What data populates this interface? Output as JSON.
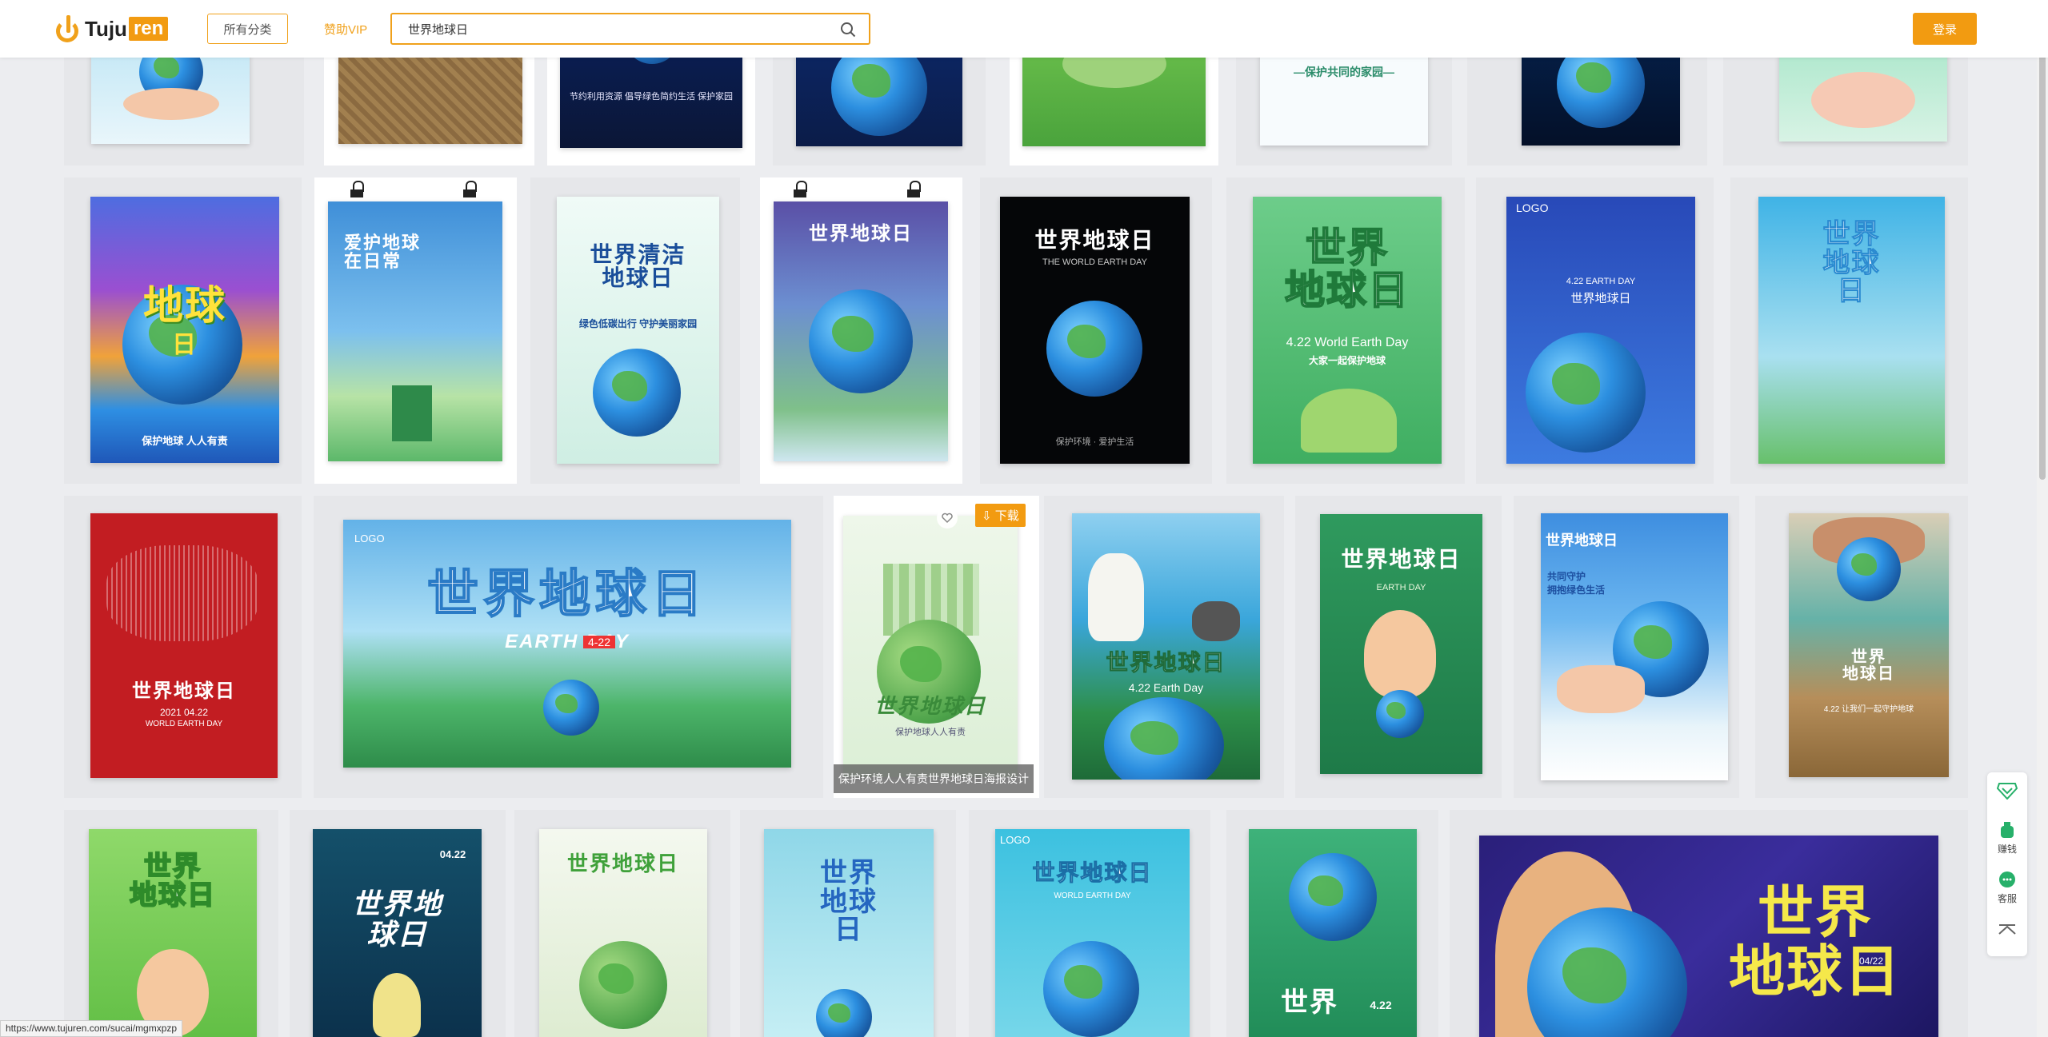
{
  "header": {
    "logo_text": "Tuju",
    "logo_badge": "ren",
    "category_button": "所有分类",
    "vip_link": "赞助VIP",
    "search_value": "世界地球日",
    "login_button": "登录"
  },
  "hovered_card": {
    "download_label": "下载",
    "caption": "保护环境人人有责世界地球日海报设计"
  },
  "posters": {
    "r1c6": "—保护共同的家园—",
    "r1c2": "节约利用资源 倡导绿色简约生活 保护家园",
    "r2c1_main": "地球",
    "r2c1_sub": "日",
    "r2c1_foot": "保护地球 人人有责",
    "r2c2_main": "爱护地球\n在日常",
    "r2c3_main": "世界清洁\n地球日",
    "r2c3_sub": "绿色低碳出行 守护美丽家园",
    "r2c4_main": "世界地球日",
    "r2c5_main": "世界地球日",
    "r2c5_sub": "THE WORLD EARTH DAY",
    "r2c5_foot": "保护环境 · 爱护生活",
    "r2c6_main": "世界\n地球日",
    "r2c6_sub": "4.22 World Earth Day",
    "r2c6_foot": "大家一起保护地球",
    "r2c7_logo": "LOGO",
    "r2c7_main": "世界地球日",
    "r2c7_sub": "4.22 EARTH DAY",
    "r2c8_main": "世界\n地球\n日",
    "r3c1_main": "世界地球日",
    "r3c1_date": "2021 04.22",
    "r3c1_sub": "WORLD EARTH DAY",
    "r3c2_logo": "LOGO",
    "r3c2_main": "世界地球日",
    "r3c2_sub": "EARTH DAY",
    "r3c2_date": "4-22",
    "r3c3_main": "世界地球日",
    "r3c3_sub": "保护地球人人有责",
    "r3c4_main": "世界地球日",
    "r3c4_sub": "4.22 Earth Day",
    "r3c5_main": "世界地球日",
    "r3c5_sub": "EARTH DAY",
    "r3c6_main": "世界地球日",
    "r3c6_sub": "共同守护\n拥抱绿色生活",
    "r3c7_main": "世界\n地球日",
    "r3c7_sub": "4.22 让我们一起守护地球",
    "r4c1_main": "世界\n地球日",
    "r4c2_main": "世界地\n球日",
    "r4c2_date": "04.22",
    "r4c3_main": "世界地球日",
    "r4c4_main": "世界\n地球\n日",
    "r4c5_logo": "LOGO",
    "r4c5_main": "世界地球日",
    "r4c5_sub": "WORLD EARTH DAY",
    "r4c6_main": "世界",
    "r4c6_date": "4.22",
    "r4c7_main": "世界\n地球日",
    "r4c7_date": "04/22"
  },
  "side_widget": {
    "earn_label": "赚钱",
    "service_label": "客服"
  },
  "status_url": "https://www.tujuren.com/sucai/mgmxpzp",
  "colors": {
    "accent": "#f29b11",
    "background": "#ecedf0"
  }
}
